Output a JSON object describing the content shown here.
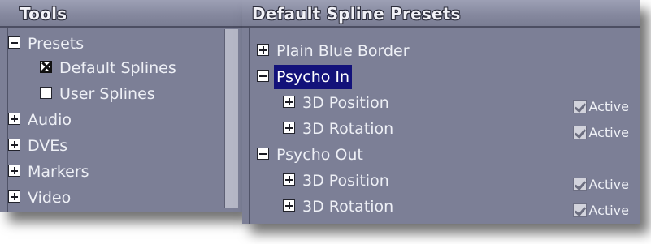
{
  "tools": {
    "title": "Tools",
    "items": [
      {
        "label": "Presets",
        "kind": "collapse"
      },
      {
        "label": "Default Splines",
        "kind": "checkbox",
        "checked": true
      },
      {
        "label": "User Splines",
        "kind": "checkbox",
        "checked": false
      },
      {
        "label": "Audio",
        "kind": "expand"
      },
      {
        "label": "DVEs",
        "kind": "expand"
      },
      {
        "label": "Markers",
        "kind": "expand"
      },
      {
        "label": "Video",
        "kind": "expand"
      }
    ]
  },
  "presets": {
    "title": "Default Spline Presets",
    "items": [
      {
        "label": "Plain Blue Border",
        "kind": "expand"
      },
      {
        "label": "Psycho In",
        "kind": "collapse",
        "selected": true
      },
      {
        "label": "3D Position",
        "kind": "expand",
        "active_label": "Active",
        "active": true
      },
      {
        "label": "3D Rotation",
        "kind": "expand",
        "active_label": "Active",
        "active": true
      },
      {
        "label": "Psycho Out",
        "kind": "collapse"
      },
      {
        "label": "3D Position",
        "kind": "expand",
        "active_label": "Active",
        "active": true
      },
      {
        "label": "3D Rotation",
        "kind": "expand",
        "active_label": "Active",
        "active": true
      }
    ]
  },
  "colors": {
    "panel_bg": "#7c7f96",
    "selection": "#13127a",
    "text": "#eef0f6"
  },
  "icons": {
    "expand": "plus-box-icon",
    "collapse": "minus-box-icon",
    "checkbox": "checkbox-icon",
    "active": "checkmark-icon"
  }
}
